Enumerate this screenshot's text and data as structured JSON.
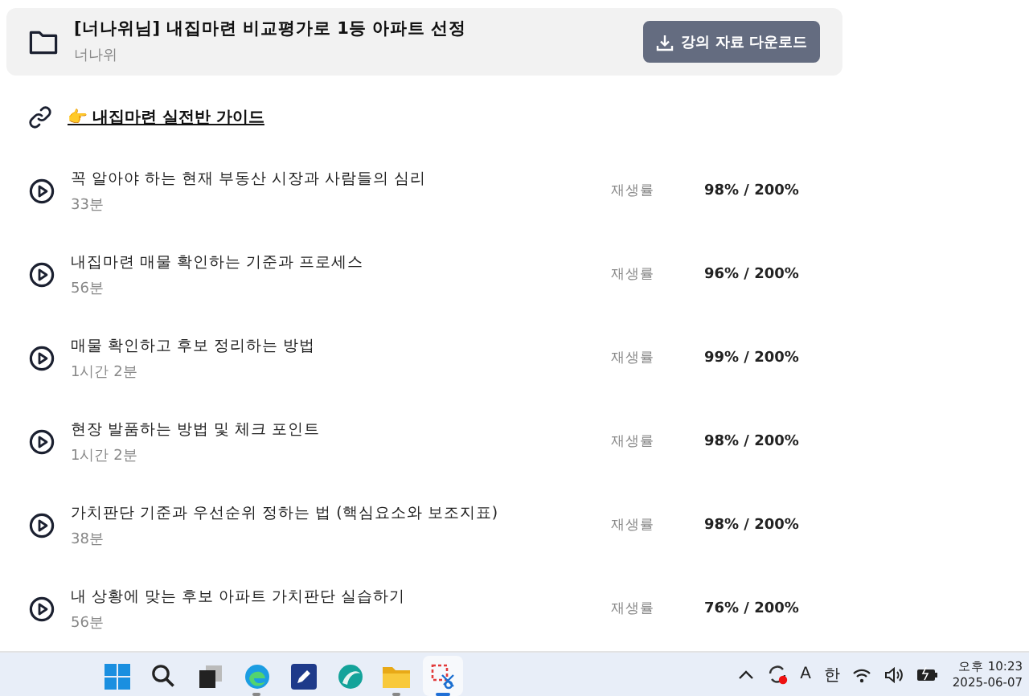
{
  "course": {
    "title": "[너나위님] 내집마련 비교평가로 1등 아파트 선정",
    "author": "너나위",
    "download_button": "강의 자료 다운로드"
  },
  "guide_link": "👉 내집마련 실전반 가이드",
  "lectures": [
    {
      "title": "꼭 알아야 하는 현재 부동산 시장과 사람들의 심리",
      "duration": "33분",
      "progress_label": "재생률",
      "progress": "98% / 200%"
    },
    {
      "title": "내집마련 매물 확인하는 기준과 프로세스",
      "duration": "56분",
      "progress_label": "재생률",
      "progress": "96% / 200%"
    },
    {
      "title": "매물 확인하고 후보 정리하는 방법",
      "duration": "1시간 2분",
      "progress_label": "재생률",
      "progress": "99% / 200%"
    },
    {
      "title": "현장 발품하는 방법 및 체크 포인트",
      "duration": "1시간 2분",
      "progress_label": "재생률",
      "progress": "98% / 200%"
    },
    {
      "title": "가치판단 기준과 우선순위 정하는 법 (핵심요소와 보조지표)",
      "duration": "38분",
      "progress_label": "재생률",
      "progress": "98% / 200%"
    },
    {
      "title": "내 상황에 맞는 후보 아파트 가치판단 실습하기",
      "duration": "56분",
      "progress_label": "재생률",
      "progress": "76% / 200%"
    }
  ],
  "taskbar": {
    "apps": [
      {
        "kind": "start",
        "running": false,
        "selected": false
      },
      {
        "kind": "search",
        "running": false,
        "selected": false
      },
      {
        "kind": "taskview",
        "running": false,
        "selected": false
      },
      {
        "kind": "edge",
        "running": true,
        "selected": false
      },
      {
        "kind": "note",
        "running": false,
        "selected": false
      },
      {
        "kind": "swirl",
        "running": false,
        "selected": false
      },
      {
        "kind": "folder",
        "running": true,
        "selected": false
      },
      {
        "kind": "snip",
        "running": true,
        "selected": true
      }
    ],
    "tray": {
      "input_mode": "A",
      "ime": "한",
      "time": "오후 10:23",
      "date": "2025-06-07"
    }
  }
}
